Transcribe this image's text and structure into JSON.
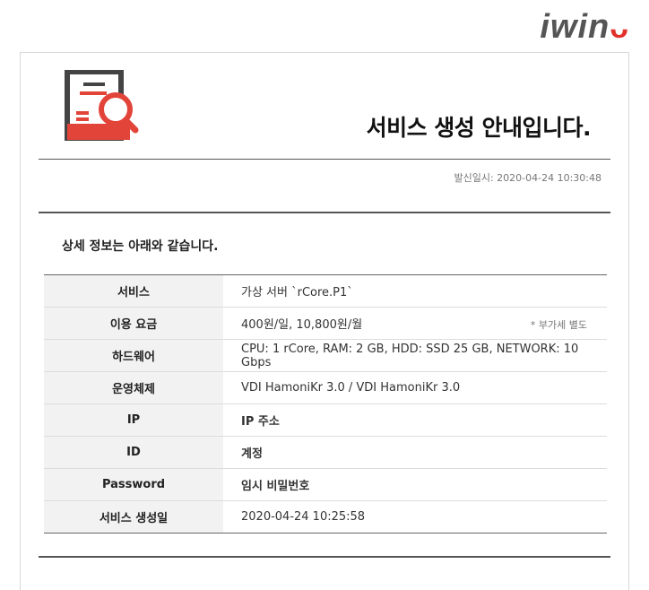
{
  "brand": {
    "logo_text": "iwin",
    "logo_mark": "ᴗ"
  },
  "header": {
    "title": "서비스 생성 안내입니다."
  },
  "sent": {
    "label": "발신일시:",
    "value": "2020-04-24 10:30:48"
  },
  "section": {
    "title": "상세 정보는 아래와 같습니다."
  },
  "rows": [
    {
      "label": "서비스",
      "value": "가상 서버 `rCore.P1`"
    },
    {
      "label": "이용 요금",
      "value": "400원/일, 10,800원/월",
      "note": "* 부가세 별도"
    },
    {
      "label": "하드웨어",
      "value": "CPU: 1 rCore, RAM: 2 GB, HDD: SSD 25 GB, NETWORK: 10 Gbps"
    },
    {
      "label": "운영체제",
      "value": "VDI HamoniKr 3.0 / VDI HamoniKr 3.0"
    },
    {
      "label": "IP",
      "value": "IP 주소"
    },
    {
      "label": "ID",
      "value": "계정"
    },
    {
      "label": "Password",
      "value": "임시 비밀번호"
    },
    {
      "label": "서비스 생성일",
      "value": "2020-04-24 10:25:58"
    }
  ],
  "colors": {
    "accent": "#e2443a",
    "icon_dark": "#444444",
    "highlight": "#e00000"
  },
  "icons": {
    "header": "document-search-icon"
  }
}
